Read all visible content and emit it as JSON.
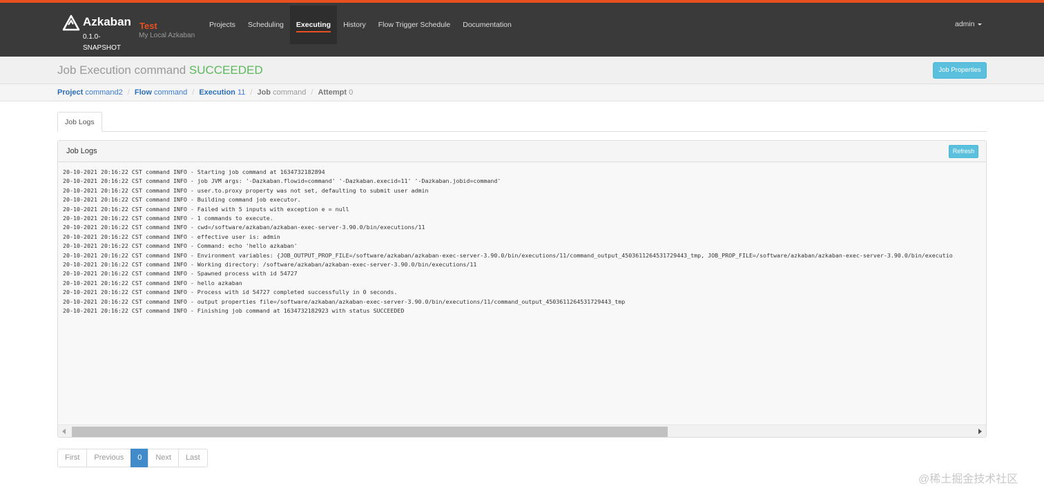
{
  "topbar": {
    "brand": {
      "name": "Azkaban",
      "version": "0.1.0-SNAPSHOT",
      "logo_icon": "azkaban-logo-icon"
    },
    "environment": {
      "name": "Test",
      "description": "My Local Azkaban"
    },
    "nav": [
      {
        "label": "Projects",
        "active": false
      },
      {
        "label": "Scheduling",
        "active": false
      },
      {
        "label": "Executing",
        "active": true
      },
      {
        "label": "History",
        "active": false
      },
      {
        "label": "Flow Trigger Schedule",
        "active": false
      },
      {
        "label": "Documentation",
        "active": false
      }
    ],
    "user": {
      "name": "admin",
      "icon": "caret-down-icon"
    }
  },
  "header": {
    "title_prefix": "Job Execution command",
    "status": "SUCCEEDED",
    "job_properties_label": "Job Properties"
  },
  "breadcrumb": [
    {
      "key": "Project",
      "value": "command2"
    },
    {
      "key": "Flow",
      "value": "command"
    },
    {
      "key": "Execution",
      "value": "11"
    },
    {
      "key": "Job",
      "value": "command"
    },
    {
      "key": "Attempt",
      "value": "0"
    }
  ],
  "tabs": [
    {
      "label": "Job Logs"
    }
  ],
  "log_panel": {
    "title": "Job Logs",
    "refresh_label": "Refresh",
    "lines": [
      "20-10-2021 20:16:22 CST command INFO - Starting job command at 1634732182894",
      "20-10-2021 20:16:22 CST command INFO - job JVM args: '-Dazkaban.flowid=command' '-Dazkaban.execid=11' '-Dazkaban.jobid=command'",
      "20-10-2021 20:16:22 CST command INFO - user.to.proxy property was not set, defaulting to submit user admin",
      "20-10-2021 20:16:22 CST command INFO - Building command job executor.",
      "20-10-2021 20:16:22 CST command INFO - Failed with 5 inputs with exception e = null",
      "20-10-2021 20:16:22 CST command INFO - 1 commands to execute.",
      "20-10-2021 20:16:22 CST command INFO - cwd=/software/azkaban/azkaban-exec-server-3.90.0/bin/executions/11",
      "20-10-2021 20:16:22 CST command INFO - effective user is: admin",
      "20-10-2021 20:16:22 CST command INFO - Command: echo 'hello azkaban'",
      "20-10-2021 20:16:22 CST command INFO - Environment variables: {JOB_OUTPUT_PROP_FILE=/software/azkaban/azkaban-exec-server-3.90.0/bin/executions/11/command_output_4503611264531729443_tmp, JOB_PROP_FILE=/software/azkaban/azkaban-exec-server-3.90.0/bin/executio",
      "20-10-2021 20:16:22 CST command INFO - Working directory: /software/azkaban/azkaban-exec-server-3.90.0/bin/executions/11",
      "20-10-2021 20:16:22 CST command INFO - Spawned process with id 54727",
      "20-10-2021 20:16:22 CST command INFO - hello azkaban",
      "20-10-2021 20:16:22 CST command INFO - Process with id 54727 completed successfully in 0 seconds.",
      "20-10-2021 20:16:22 CST command INFO - output properties file=/software/azkaban/azkaban-exec-server-3.90.0/bin/executions/11/command_output_4503611264531729443_tmp",
      "20-10-2021 20:16:22 CST command INFO - Finishing job command at 1634732182923 with status SUCCEEDED"
    ],
    "scroll_position": 0.0,
    "scroll_visible_fraction": 0.66
  },
  "pagination": [
    {
      "label": "First",
      "active": false
    },
    {
      "label": "Previous",
      "active": false
    },
    {
      "label": "0",
      "active": true
    },
    {
      "label": "Next",
      "active": false
    },
    {
      "label": "Last",
      "active": false
    }
  ],
  "watermark": "@稀土掘金技术社区",
  "colors": {
    "accent": "#e8501f",
    "topbar_bg": "#3a3a3a",
    "success": "#5cb85c",
    "info_button": "#5bc0de",
    "link": "#2a6ebb",
    "active_page": "#428bca"
  }
}
